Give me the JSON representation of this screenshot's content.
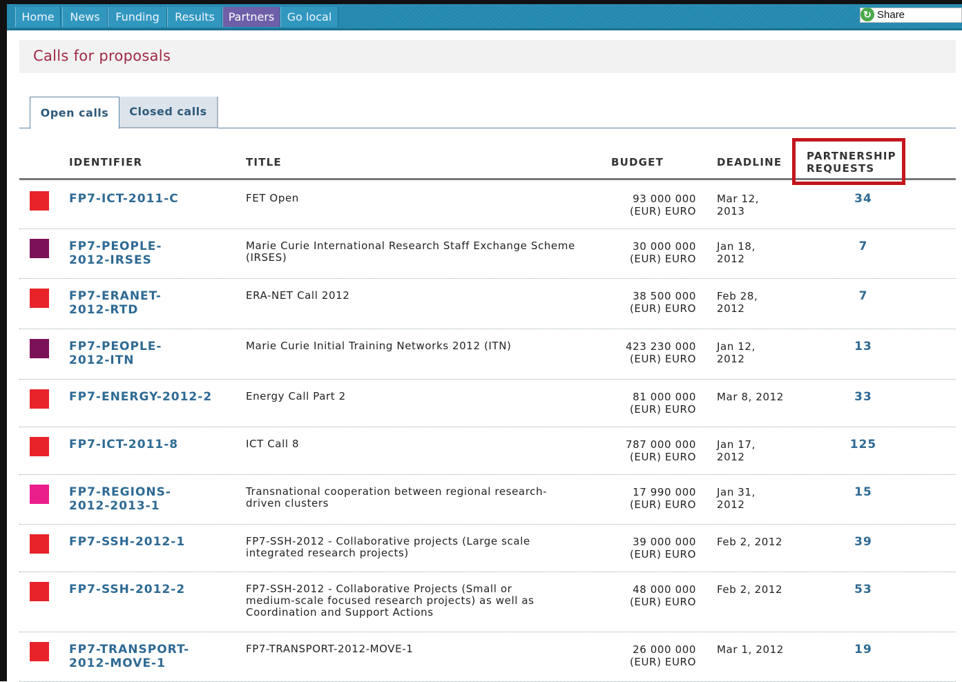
{
  "nav": {
    "items": [
      "Home",
      "News",
      "Funding",
      "Results",
      "Partners",
      "Go local"
    ],
    "active": "Partners",
    "share_label": "Share"
  },
  "page": {
    "title": "Calls for proposals"
  },
  "tabs": {
    "open": "Open calls",
    "closed": "Closed calls",
    "selected": "Open calls"
  },
  "table": {
    "headers": {
      "identifier": "IDENTIFIER",
      "title": "TITLE",
      "budget": "BUDGET",
      "deadline": "DEADLINE",
      "partnership_line1": "PARTNERSHIP",
      "partnership_line2": "REQUESTS"
    },
    "rows": [
      {
        "id1": "FP7-ICT-2011-C",
        "id2": "",
        "title": [
          "FET Open"
        ],
        "budget": "93 000 000",
        "currency": "(EUR) EURO",
        "dl1": "Mar 12,",
        "dl2": "2013",
        "requests": "34",
        "color": "#e8232a"
      },
      {
        "id1": "FP7-PEOPLE-",
        "id2": "2012-IRSES",
        "title": [
          "Marie Curie International Research Staff Exchange Scheme",
          "(IRSES)"
        ],
        "budget": "30 000 000",
        "currency": "(EUR) EURO",
        "dl1": "Jan 18,",
        "dl2": "2012",
        "requests": "7",
        "color": "#7b1258"
      },
      {
        "id1": "FP7-ERANET-",
        "id2": "2012-RTD",
        "title": [
          "ERA-NET Call 2012"
        ],
        "budget": "38 500 000",
        "currency": "(EUR) EURO",
        "dl1": "Feb 28,",
        "dl2": "2012",
        "requests": "7",
        "color": "#e8232a"
      },
      {
        "id1": "FP7-PEOPLE-",
        "id2": "2012-ITN",
        "title": [
          "Marie Curie Initial Training Networks 2012 (ITN)"
        ],
        "budget": "423 230 000",
        "currency": "(EUR) EURO",
        "dl1": "Jan 12,",
        "dl2": "2012",
        "requests": "13",
        "color": "#7b1258"
      },
      {
        "id1": "FP7-ENERGY-2012-2",
        "id2": "",
        "title": [
          "Energy Call Part 2"
        ],
        "budget": "81 000 000",
        "currency": "(EUR) EURO",
        "dl1": "Mar 8, 2012",
        "dl2": "",
        "requests": "33",
        "color": "#e8232a"
      },
      {
        "id1": "FP7-ICT-2011-8",
        "id2": "",
        "title": [
          "ICT Call 8"
        ],
        "budget": "787 000 000",
        "currency": "(EUR) EURO",
        "dl1": "Jan 17,",
        "dl2": "2012",
        "requests": "125",
        "color": "#e8232a"
      },
      {
        "id1": "FP7-REGIONS-",
        "id2": "2012-2013-1",
        "title": [
          "Transnational cooperation between regional research-",
          "driven clusters"
        ],
        "budget": "17 990 000",
        "currency": "(EUR) EURO",
        "dl1": "Jan 31,",
        "dl2": "2012",
        "requests": "15",
        "color": "#ea1f8c"
      },
      {
        "id1": "FP7-SSH-2012-1",
        "id2": "",
        "title": [
          "FP7-SSH-2012 - Collaborative projects (Large scale",
          "integrated research projects)"
        ],
        "budget": "39 000 000",
        "currency": "(EUR) EURO",
        "dl1": "Feb 2, 2012",
        "dl2": "",
        "requests": "39",
        "color": "#e8232a"
      },
      {
        "id1": "FP7-SSH-2012-2",
        "id2": "",
        "title": [
          "FP7-SSH-2012 - Collaborative Projects (Small or",
          "medium-scale focused research projects) as well as",
          "Coordination and Support Actions"
        ],
        "budget": "48 000 000",
        "currency": "(EUR) EURO",
        "dl1": "Feb 2, 2012",
        "dl2": "",
        "requests": "53",
        "color": "#e8232a"
      },
      {
        "id1": "FP7-TRANSPORT-",
        "id2": "2012-MOVE-1",
        "title": [
          "FP7-TRANSPORT-2012-MOVE-1"
        ],
        "budget": "26 000 000",
        "currency": "(EUR) EURO",
        "dl1": "Mar 1, 2012",
        "dl2": "",
        "requests": "19",
        "color": "#e8232a"
      }
    ]
  }
}
